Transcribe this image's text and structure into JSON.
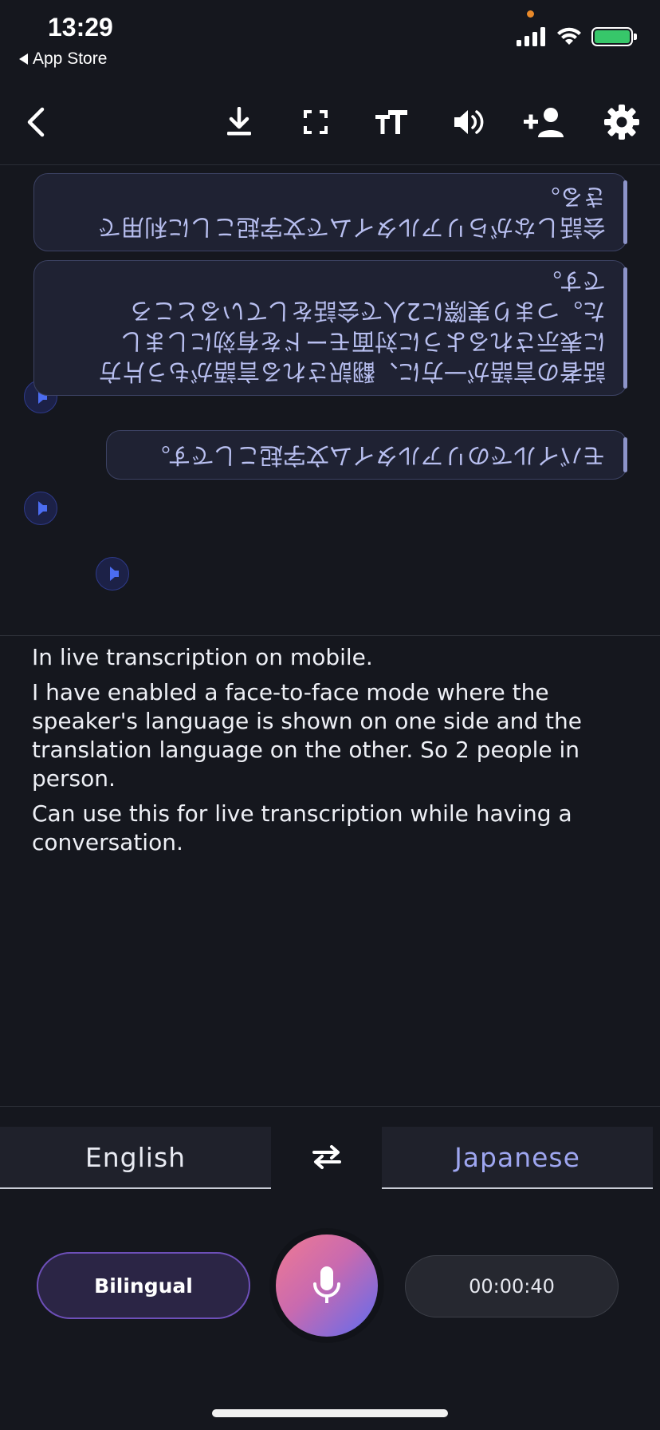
{
  "status_bar": {
    "time": "13:29",
    "back_app": "App Store",
    "signal_icon": "cellular-signal-icon",
    "wifi_icon": "wifi-icon",
    "battery_icon": "battery-charging-icon"
  },
  "toolbar": {
    "items": [
      {
        "name": "back-icon"
      },
      {
        "name": "download-icon"
      },
      {
        "name": "fullscreen-icon"
      },
      {
        "name": "text-size-icon"
      },
      {
        "name": "speaker-icon"
      },
      {
        "name": "add-person-icon"
      },
      {
        "name": "settings-icon"
      }
    ]
  },
  "flipped_messages": [
    {
      "lines": [
        "会話しながらリアルタイムで文字起こしに利用で",
        "きる。"
      ]
    },
    {
      "lines": [
        "話者の言語が一方に、翻訳される言語がもう片方",
        "に表示されるように対面モードを有効にしまし",
        "た。つまり実際に2人で会話をしているところ",
        "です。"
      ]
    },
    {
      "lines": [
        "モバイルでのリアルタイム文字起こしです。"
      ]
    }
  ],
  "transcript": {
    "paragraphs": [
      "In live transcription on mobile.",
      "I have enabled a face-to-face mode where the speaker's language is shown on one side and the translation language on the other. So 2 people in person.",
      "Can use this for live transcription while having a conversation."
    ]
  },
  "languages": {
    "source": "English",
    "target": "Japanese"
  },
  "controls": {
    "mode_label": "Bilingual",
    "timer": "00:00:40"
  },
  "colors": {
    "background": "#15171e",
    "accent_purple": "#6d4fb8",
    "target_language": "#9ea6f0",
    "flipped_text": "#b8bff0"
  }
}
